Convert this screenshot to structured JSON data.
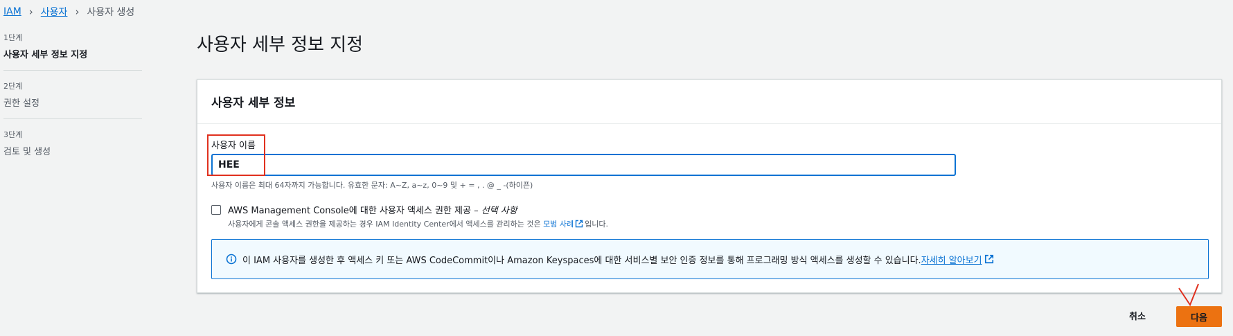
{
  "breadcrumb": {
    "items": [
      "IAM",
      "사용자",
      "사용자 생성"
    ]
  },
  "steps": [
    {
      "num": "1단계",
      "label": "사용자 세부 정보 지정"
    },
    {
      "num": "2단계",
      "label": "권한 설정"
    },
    {
      "num": "3단계",
      "label": "검토 및 생성"
    }
  ],
  "page": {
    "title": "사용자 세부 정보 지정"
  },
  "panel": {
    "title": "사용자 세부 정보",
    "username_label": "사용자 이름",
    "username_value": "HEE",
    "username_hint": "사용자 이름은 최대 64자까지 가능합니다. 유효한 문자: A~Z, a~z, 0~9 및 + = , . @ _ -(하이픈)",
    "console_access": {
      "title": "AWS Management Console에 대한 사용자 액세스 권한 제공 – ",
      "optional": "선택 사항",
      "desc_before": "사용자에게 콘솔 액세스 권한을 제공하는 경우 IAM Identity Center에서 액세스를 관리하는 것은 ",
      "desc_link": "모범 사례",
      "desc_after": "입니다."
    },
    "info": {
      "text": "이 IAM 사용자를 생성한 후 액세스 키 또는 AWS CodeCommit이나 Amazon Keyspaces에 대한 서비스별 보안 인증 정보를 통해 프로그래밍 방식 액세스를 생성할 수 있습니다. ",
      "link": "자세히 알아보기"
    }
  },
  "footer": {
    "cancel_label": "취소",
    "next_label": "다음"
  },
  "colors": {
    "link": "#0972d3",
    "primary_button": "#ec7211",
    "annotation": "#e0301e"
  }
}
